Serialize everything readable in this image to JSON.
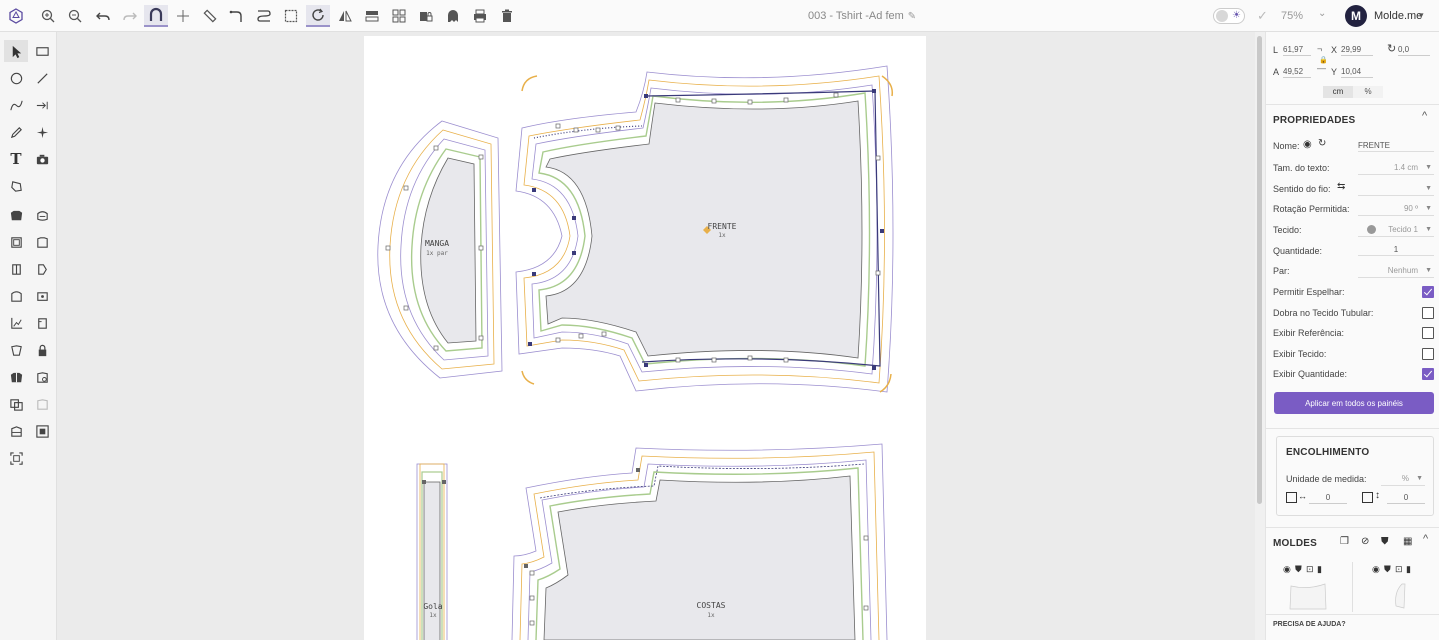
{
  "document": {
    "title": "003 - Tshirt -Ad fem"
  },
  "header": {
    "zoom": "75%",
    "avatar_initial": "M",
    "username": "Molde.me"
  },
  "canvas": {
    "pieces": [
      {
        "name": "MANGA",
        "sub": "1x par"
      },
      {
        "name": "FRENTE",
        "sub": "1x"
      },
      {
        "name": "Gola",
        "sub": "1x"
      },
      {
        "name": "COSTAS",
        "sub": "1x"
      }
    ]
  },
  "transform": {
    "l_label": "L",
    "l_value": "61,97",
    "x_label": "X",
    "x_value": "29,99",
    "rotation_value": "0,0",
    "a_label": "A",
    "a_value": "49,52",
    "y_label": "Y",
    "y_value": "10,04",
    "unit_cm": "cm",
    "unit_pct": "%"
  },
  "properties": {
    "title": "PROPRIEDADES",
    "name_label": "Nome:",
    "name_value": "FRENTE",
    "text_size_label": "Tam. do texto:",
    "text_size_value": "1.4 cm",
    "grain_label": "Sentido do fio:",
    "grain_value": "",
    "rotation_label": "Rotação Permitida:",
    "rotation_value": "90 º",
    "fabric_label": "Tecido:",
    "fabric_value": "Tecido 1",
    "quantity_label": "Quantidade:",
    "quantity_value": "1",
    "pair_label": "Par:",
    "pair_value": "Nenhum",
    "mirror_label": "Permitir Espelhar:",
    "mirror_checked": true,
    "tubular_label": "Dobra no Tecido Tubular:",
    "tubular_checked": false,
    "reference_label": "Exibir Referência:",
    "reference_checked": false,
    "show_fabric_label": "Exibir Tecido:",
    "show_fabric_checked": false,
    "show_quantity_label": "Exibir Quantidade:",
    "show_quantity_checked": true,
    "apply_label": "Aplicar em todos os painéis"
  },
  "shrinkage": {
    "title": "ENCOLHIMENTO",
    "unit_label": "Unidade de medida:",
    "unit_value": "%",
    "horizontal_value": "0",
    "vertical_value": "0"
  },
  "molds": {
    "title": "MOLDES"
  },
  "help": {
    "label": "PRECISA DE AJUDA?"
  },
  "colors": {
    "accent": "#7a5cc4",
    "outline_purple": "#9b8ecf",
    "seam_orange": "#e8b04a",
    "seam_green": "#a9cc8e"
  }
}
